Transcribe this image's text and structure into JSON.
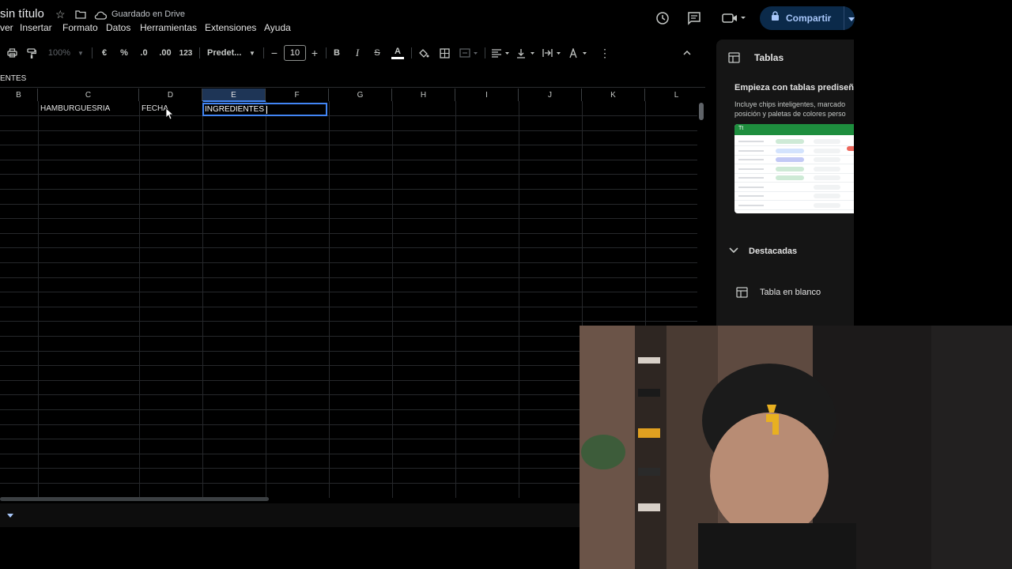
{
  "header": {
    "title": "sin título",
    "save_status": "Guardado en Drive",
    "share_label": "Compartir"
  },
  "menu": [
    "Ver",
    "Insertar",
    "Formato",
    "Datos",
    "Herramientas",
    "Extensiones",
    "Ayuda"
  ],
  "menu_visible": [
    "ver",
    "Insertar",
    "Formato",
    "Datos",
    "Herramientas",
    "Extensiones",
    "Ayuda"
  ],
  "toolbar": {
    "zoom": "100%",
    "currency": "€",
    "percent": "%",
    "dec_decrease": ".0",
    "dec_increase": ".00",
    "format_123": "123",
    "font": "Predet...",
    "font_size": "10",
    "bold": "B",
    "italic": "I",
    "strike": "S",
    "text_color_glyph": "A",
    "text_color": "#ffffff"
  },
  "formula_bar": {
    "content": "ENTES"
  },
  "grid": {
    "columns": [
      "B",
      "C",
      "D",
      "E",
      "F",
      "G",
      "H",
      "I",
      "J",
      "K",
      "L"
    ],
    "selected_column": "E",
    "row1": {
      "C": "HAMBURGUESRIA",
      "D": "FECHA",
      "E": "INGREDIENTES"
    }
  },
  "side_panel": {
    "title": "Tablas",
    "heading": "Empieza con tablas prediseñ",
    "desc_line1": "Incluye chips inteligentes, marcado",
    "desc_line2": "posición y paletas de colores perso",
    "preview_header": "Tt",
    "section_label": "Destacadas",
    "blank_table_label": "Tabla en blanco"
  },
  "colors": {
    "background": "#000000",
    "accent_blue": "#4285f4",
    "share_bg": "#0b2a4a",
    "share_text": "#a8c7fa",
    "panel_bg": "#151515",
    "preview_green": "#1e8e3e"
  }
}
